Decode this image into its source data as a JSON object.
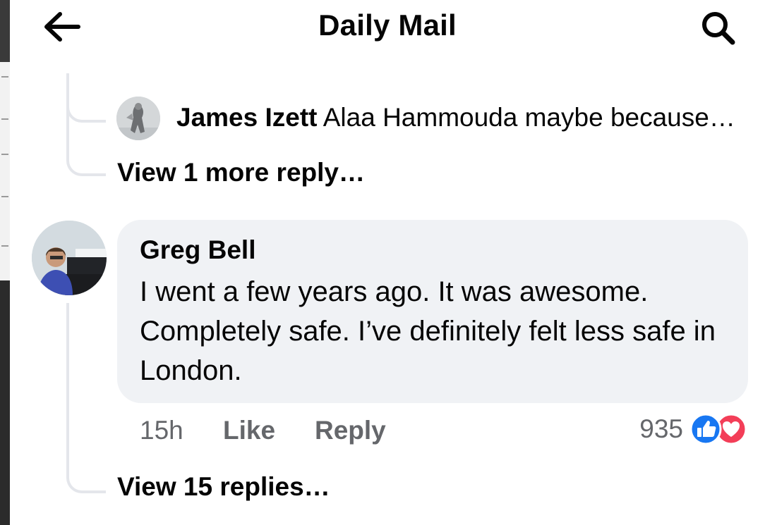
{
  "header": {
    "title": "Daily Mail",
    "back_icon": "arrow-left-icon",
    "search_icon": "search-icon"
  },
  "nested_reply": {
    "author": "James Izett",
    "text": "Alaa Hammouda maybe because…",
    "view_more": "View 1 more reply…"
  },
  "comment": {
    "author": "Greg Bell",
    "body": "I went a few years ago. It was awesome. Completely safe. I’ve definitely felt less safe in London.",
    "time": "15h",
    "like_label": "Like",
    "reply_label": "Reply",
    "reaction_count": "935",
    "reactions": [
      "like-reaction-icon",
      "love-reaction-icon"
    ],
    "view_replies": "View 15 replies…"
  },
  "colors": {
    "text": "#050505",
    "secondary_text": "#65676b",
    "bubble_bg": "#f0f2f5",
    "thread_line": "#e4e6eb",
    "like_blue": "#1877f2",
    "love_red": "#f33e58"
  }
}
